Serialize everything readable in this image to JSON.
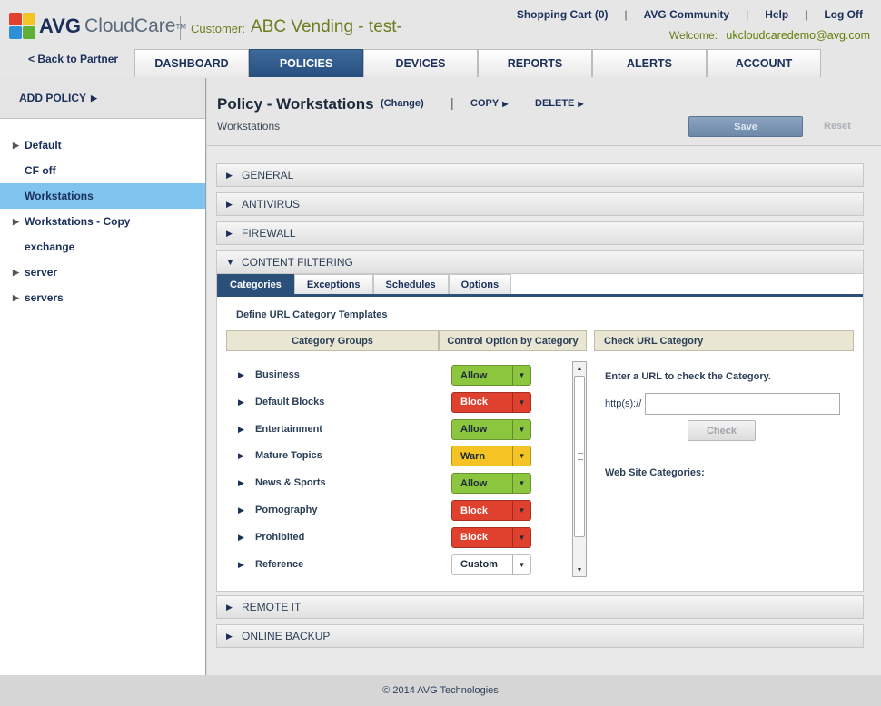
{
  "brand": {
    "avg": "AVG",
    "cloudcare": "CloudCare",
    "tm": "TM"
  },
  "customer": {
    "label": "Customer:",
    "name": "ABC Vending - test-"
  },
  "toplinks": {
    "cart": "Shopping Cart (0)",
    "community": "AVG Community",
    "help": "Help",
    "logoff": "Log Off",
    "sep": "|"
  },
  "welcome": {
    "label": "Welcome:",
    "user": "ukcloudcaredemo@avg.com"
  },
  "back_link": "< Back to Partner",
  "nav": [
    "DASHBOARD",
    "POLICIES",
    "DEVICES",
    "REPORTS",
    "ALERTS",
    "ACCOUNT"
  ],
  "nav_active": "POLICIES",
  "sidebar": {
    "add_policy": "ADD POLICY",
    "policies": [
      {
        "label": "Default",
        "expandable": true
      },
      {
        "label": "CF off",
        "expandable": false
      },
      {
        "label": "Workstations",
        "expandable": false,
        "active": true
      },
      {
        "label": "Workstations - Copy",
        "expandable": true
      },
      {
        "label": "exchange",
        "expandable": false
      },
      {
        "label": "server",
        "expandable": true
      },
      {
        "label": "servers",
        "expandable": true
      }
    ]
  },
  "policy": {
    "title": "Policy - Workstations",
    "change": "(Change)",
    "copy": "COPY",
    "delete": "DELETE",
    "subtitle": "Workstations",
    "save": "Save",
    "reset": "Reset"
  },
  "sections": {
    "general": "GENERAL",
    "antivirus": "ANTIVIRUS",
    "firewall": "FIREWALL",
    "content_filtering": "CONTENT FILTERING",
    "remote_it": "REMOTE IT",
    "online_backup": "ONLINE BACKUP"
  },
  "cf": {
    "tabs": [
      "Categories",
      "Exceptions",
      "Schedules",
      "Options"
    ],
    "active_tab": "Categories",
    "define_label": "Define URL Category Templates",
    "col_groups": "Category Groups",
    "col_control": "Control Option by Category",
    "col_check": "Check URL Category",
    "categories": [
      {
        "name": "Business",
        "option": "Allow"
      },
      {
        "name": "Default Blocks",
        "option": "Block"
      },
      {
        "name": "Entertainment",
        "option": "Allow"
      },
      {
        "name": "Mature Topics",
        "option": "Warn"
      },
      {
        "name": "News & Sports",
        "option": "Allow"
      },
      {
        "name": "Pornography",
        "option": "Block"
      },
      {
        "name": "Prohibited",
        "option": "Block"
      },
      {
        "name": "Reference",
        "option": "Custom"
      }
    ],
    "option_colors": {
      "Allow": "#8cc63f",
      "Block": "#e0402e",
      "Warn": "#f6c325",
      "Custom": "#ffffff"
    },
    "check_label": "Enter a URL to check the Category.",
    "http_label": "http(s)://",
    "url_value": "",
    "check_button": "Check",
    "web_site_categories": "Web Site Categories:"
  },
  "footer": "© 2014 AVG Technologies"
}
